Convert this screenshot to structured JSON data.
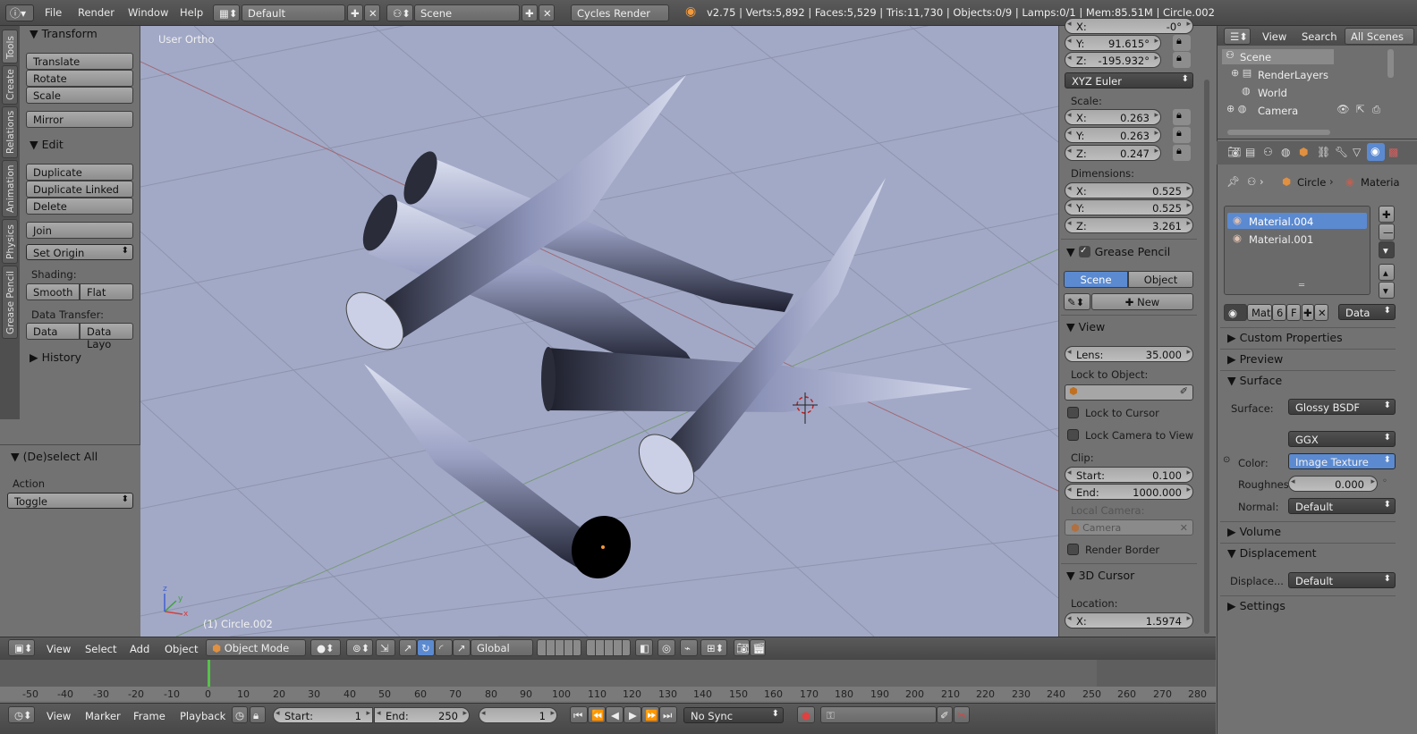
{
  "topbar": {
    "menus": [
      "File",
      "Render",
      "Window",
      "Help"
    ],
    "layout": "Default",
    "scene": "Scene",
    "engine": "Cycles Render",
    "stats": "v2.75 | Verts:5,892 | Faces:5,529 | Tris:11,730 | Objects:0/9 | Lamps:0/1 | Mem:85.51M | Circle.002"
  },
  "tool_tabs": [
    "Tools",
    "Create",
    "Relations",
    "Animation",
    "Physics",
    "Grease Pencil"
  ],
  "tools": {
    "transform_title": "Transform",
    "translate": "Translate",
    "rotate": "Rotate",
    "scale": "Scale",
    "mirror": "Mirror",
    "edit_title": "Edit",
    "duplicate": "Duplicate",
    "duplicate_linked": "Duplicate Linked",
    "delete": "Delete",
    "join": "Join",
    "set_origin": "Set Origin",
    "shading_label": "Shading:",
    "smooth": "Smooth",
    "flat": "Flat",
    "data_transfer_label": "Data Transfer:",
    "data": "Data",
    "data_layo": "Data Layo",
    "history_title": "History",
    "deselect_title": "(De)select All",
    "action_label": "Action",
    "action_value": "Toggle"
  },
  "viewport": {
    "view_label": "User Ortho",
    "object_label": "(1) Circle.002",
    "axis": {
      "x": "x",
      "y": "y",
      "z": "z"
    }
  },
  "props_panel": {
    "rot_x_label": "X:",
    "rot_x": "-0°",
    "rot_y_label": "Y:",
    "rot_y": "91.615°",
    "rot_z_label": "Z:",
    "rot_z": "-195.932°",
    "rot_mode": "XYZ Euler",
    "scale_label": "Scale:",
    "scale_x": "0.263",
    "scale_y": "0.263",
    "scale_z": "0.247",
    "dim_label": "Dimensions:",
    "dim_x": "0.525",
    "dim_y": "0.525",
    "dim_z": "3.261",
    "grease_title": "Grease Pencil",
    "gp_scene": "Scene",
    "gp_object": "Object",
    "gp_new": "New",
    "view_title": "View",
    "lens_label": "Lens:",
    "lens": "35.000",
    "lock_obj_label": "Lock to Object:",
    "lock_cursor": "Lock to Cursor",
    "lock_cam": "Lock Camera to View",
    "clip_label": "Clip:",
    "clip_start_label": "Start:",
    "clip_start": "0.100",
    "clip_end_label": "End:",
    "clip_end": "1000.000",
    "local_cam_label": "Local Camera:",
    "local_cam": "Camera",
    "render_border": "Render Border",
    "cursor_title": "3D Cursor",
    "location_label": "Location:",
    "loc_x_label": "X:",
    "loc_x": "1.5974"
  },
  "outliner": {
    "view": "View",
    "search": "Search",
    "all_scenes": "All Scenes",
    "items": [
      "Scene",
      "RenderLayers",
      "World",
      "Camera"
    ]
  },
  "properties": {
    "crumb_obj": "Circle",
    "crumb_mat": "Materia",
    "materials": [
      "Material.004",
      "Material.001"
    ],
    "mat_name": "Mat",
    "mat_users": "6",
    "mat_f": "F",
    "mat_data": "Data",
    "custom_props": "Custom Properties",
    "preview": "Preview",
    "surface_title": "Surface",
    "surface_label": "Surface:",
    "surface_val": "Glossy BSDF",
    "distribution": "GGX",
    "color_label": "Color:",
    "color_val": "Image Texture",
    "rough_label": "Roughnes",
    "rough_val": "0.000",
    "normal_label": "Normal:",
    "normal_val": "Default",
    "volume": "Volume",
    "displacement": "Displacement",
    "displace_label": "Displace...",
    "displace_val": "Default",
    "settings": "Settings"
  },
  "view3d_header": {
    "view": "View",
    "select": "Select",
    "add": "Add",
    "object": "Object",
    "mode": "Object Mode",
    "orientation": "Global"
  },
  "timeline": {
    "ticks": [
      "-50",
      "-40",
      "-30",
      "-20",
      "-10",
      "0",
      "10",
      "20",
      "30",
      "40",
      "50",
      "60",
      "70",
      "80",
      "90",
      "100",
      "110",
      "120",
      "130",
      "140",
      "150",
      "160",
      "170",
      "180",
      "190",
      "200",
      "210",
      "220",
      "230",
      "240",
      "250",
      "260",
      "270",
      "280"
    ],
    "view": "View",
    "marker": "Marker",
    "frame": "Frame",
    "playback": "Playback",
    "start_label": "Start:",
    "start": "1",
    "end_label": "End:",
    "end": "250",
    "current": "1",
    "sync": "No Sync"
  },
  "colors": {
    "viewport_bg": "#a2a9c6",
    "selected": "#5b8ad1",
    "panel": "#727272"
  }
}
